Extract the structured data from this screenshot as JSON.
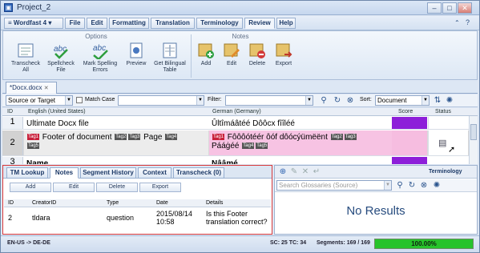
{
  "window": {
    "title": "Project_2"
  },
  "menu": {
    "app": "Wordfast 4",
    "tabs": [
      "File",
      "Edit",
      "Formatting",
      "Translation",
      "Terminology",
      "Review",
      "Help"
    ],
    "active": "Review"
  },
  "ribbon": {
    "options_label": "Options",
    "notes_label": "Notes",
    "options": [
      {
        "label": "Transcheck All",
        "icon": "transcheck-icon"
      },
      {
        "label": "Spellcheck File",
        "icon": "spellcheck-icon"
      },
      {
        "label": "Mark Spelling Errors",
        "icon": "mark-spelling-icon"
      },
      {
        "label": "Preview",
        "icon": "preview-icon"
      },
      {
        "label": "Get Bilingual Table",
        "icon": "bilingual-table-icon"
      }
    ],
    "notes": [
      {
        "label": "Add",
        "icon": "add-note-icon"
      },
      {
        "label": "Edit",
        "icon": "edit-note-icon"
      },
      {
        "label": "Delete",
        "icon": "delete-note-icon"
      },
      {
        "label": "Export",
        "icon": "export-note-icon"
      }
    ]
  },
  "document_tab": "*Docx.docx",
  "toolbar": {
    "source_target": "Source or Target",
    "match_case": "Match Case",
    "filter_label": "Filter:",
    "sort_label": "Sort:",
    "sort_value": "Document"
  },
  "grid": {
    "headers": [
      "ID",
      "English (United States)",
      "German (Germany)",
      "Score",
      "Status"
    ],
    "rows": [
      {
        "id": "1",
        "source": "Ultimate Docx file",
        "target": "Ûltîmáâtéé Dôôcx fîîléé"
      },
      {
        "id": "2",
        "source": "Footer of document",
        "source_tags": [
          "Tag1",
          "Tag2",
          "Tag3"
        ],
        "source_after": "Page",
        "source_tags2": [
          "Tag4",
          "Tag5"
        ],
        "target": "Fôôôótéér ôóf dôócýümëënt",
        "target_tags": [
          "Tag1",
          "Tag2",
          "Tag3"
        ],
        "target_after": "Pááġéé",
        "target_tags2": [
          "Tag4",
          "Tag5"
        ]
      },
      {
        "id": "3",
        "source": "Name",
        "target": "Nââmé"
      }
    ]
  },
  "notes_panel": {
    "tabs": [
      "TM Lookup",
      "Notes",
      "Segment History",
      "Context",
      "Transcheck (0)"
    ],
    "active_tab": "Notes",
    "buttons": [
      "Add",
      "Edit",
      "Delete",
      "Export"
    ],
    "headers": [
      "ID",
      "CreatorID",
      "Type",
      "Date",
      "Details"
    ],
    "rows": [
      {
        "id": "2",
        "creator": "tldara",
        "type": "question",
        "date": "2015/08/14 10:58",
        "details": "Is this Footer translation correct?"
      }
    ]
  },
  "terminology": {
    "title": "Terminology",
    "search_placeholder": "Search Glossaries (Source)",
    "empty": "No Results"
  },
  "statusbar": {
    "langs": "EN-US -> DE-DE",
    "sc_tc": "SC: 25 TC: 34",
    "segments": "Segments: 169 / 169",
    "progress": "100.00%",
    "progress_value": 1.0
  }
}
